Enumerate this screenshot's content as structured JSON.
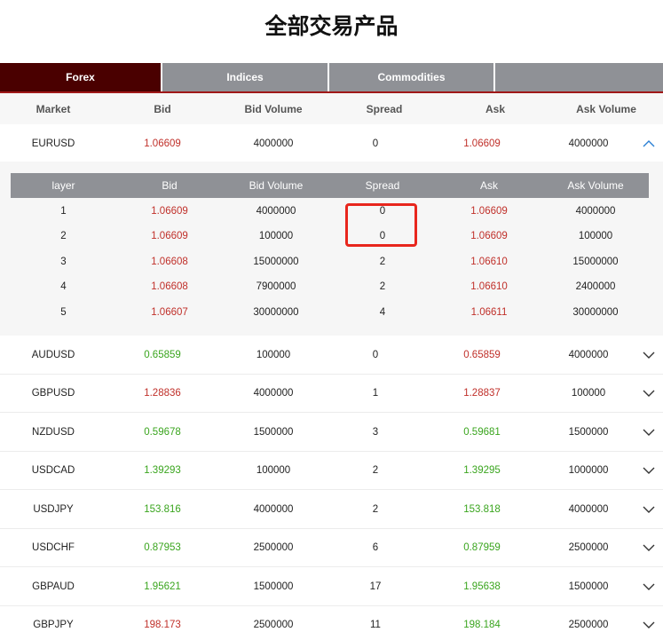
{
  "page": {
    "title": "全部交易产品"
  },
  "tabs": [
    {
      "label": "Forex",
      "active": true
    },
    {
      "label": "Indices",
      "active": false
    },
    {
      "label": "Commodities",
      "active": false
    },
    {
      "label": "",
      "active": false
    }
  ],
  "columns": [
    "Market",
    "Bid",
    "Bid Volume",
    "Spread",
    "Ask",
    "Ask Volume"
  ],
  "expanded": {
    "market": "EURUSD",
    "columns": [
      "layer",
      "Bid",
      "Bid Volume",
      "Spread",
      "Ask",
      "Ask Volume"
    ],
    "layers": [
      {
        "layer": "1",
        "bid": "1.06609",
        "bid_volume": "4000000",
        "spread": "0",
        "ask": "1.06609",
        "ask_volume": "4000000"
      },
      {
        "layer": "2",
        "bid": "1.06609",
        "bid_volume": "100000",
        "spread": "0",
        "ask": "1.06609",
        "ask_volume": "100000"
      },
      {
        "layer": "3",
        "bid": "1.06608",
        "bid_volume": "15000000",
        "spread": "2",
        "ask": "1.06610",
        "ask_volume": "15000000"
      },
      {
        "layer": "4",
        "bid": "1.06608",
        "bid_volume": "7900000",
        "spread": "2",
        "ask": "1.06610",
        "ask_volume": "2400000"
      },
      {
        "layer": "5",
        "bid": "1.06607",
        "bid_volume": "30000000",
        "spread": "4",
        "ask": "1.06611",
        "ask_volume": "30000000"
      }
    ]
  },
  "rows": [
    {
      "market": "EURUSD",
      "bid": "1.06609",
      "bid_volume": "4000000",
      "spread": "0",
      "ask": "1.06609",
      "ask_volume": "4000000",
      "color": "red",
      "expanded": true
    },
    {
      "market": "AUDUSD",
      "bid": "0.65859",
      "bid_volume": "100000",
      "spread": "0",
      "ask": "0.65859",
      "ask_volume": "4000000",
      "bid_color": "green",
      "ask_color": "red"
    },
    {
      "market": "GBPUSD",
      "bid": "1.28836",
      "bid_volume": "4000000",
      "spread": "1",
      "ask": "1.28837",
      "ask_volume": "100000",
      "bid_color": "red",
      "ask_color": "red"
    },
    {
      "market": "NZDUSD",
      "bid": "0.59678",
      "bid_volume": "1500000",
      "spread": "3",
      "ask": "0.59681",
      "ask_volume": "1500000",
      "bid_color": "green",
      "ask_color": "green"
    },
    {
      "market": "USDCAD",
      "bid": "1.39293",
      "bid_volume": "100000",
      "spread": "2",
      "ask": "1.39295",
      "ask_volume": "1000000",
      "bid_color": "green",
      "ask_color": "green"
    },
    {
      "market": "USDJPY",
      "bid": "153.816",
      "bid_volume": "4000000",
      "spread": "2",
      "ask": "153.818",
      "ask_volume": "4000000",
      "bid_color": "green",
      "ask_color": "green"
    },
    {
      "market": "USDCHF",
      "bid": "0.87953",
      "bid_volume": "2500000",
      "spread": "6",
      "ask": "0.87959",
      "ask_volume": "2500000",
      "bid_color": "green",
      "ask_color": "green"
    },
    {
      "market": "GBPAUD",
      "bid": "1.95621",
      "bid_volume": "1500000",
      "spread": "17",
      "ask": "1.95638",
      "ask_volume": "1500000",
      "bid_color": "green",
      "ask_color": "green"
    },
    {
      "market": "GBPJPY",
      "bid": "198.173",
      "bid_volume": "2500000",
      "spread": "11",
      "ask": "198.184",
      "ask_volume": "2500000",
      "bid_color": "red",
      "ask_color": "green"
    }
  ],
  "colors": {
    "red": "#c0302a",
    "green": "#3aa51e",
    "tab_active": "#4a0000",
    "tab_inactive": "#8f9196",
    "highlight": "#e8261d"
  },
  "icons": {
    "expand": "chevron-down-icon",
    "collapse": "chevron-up-icon"
  }
}
